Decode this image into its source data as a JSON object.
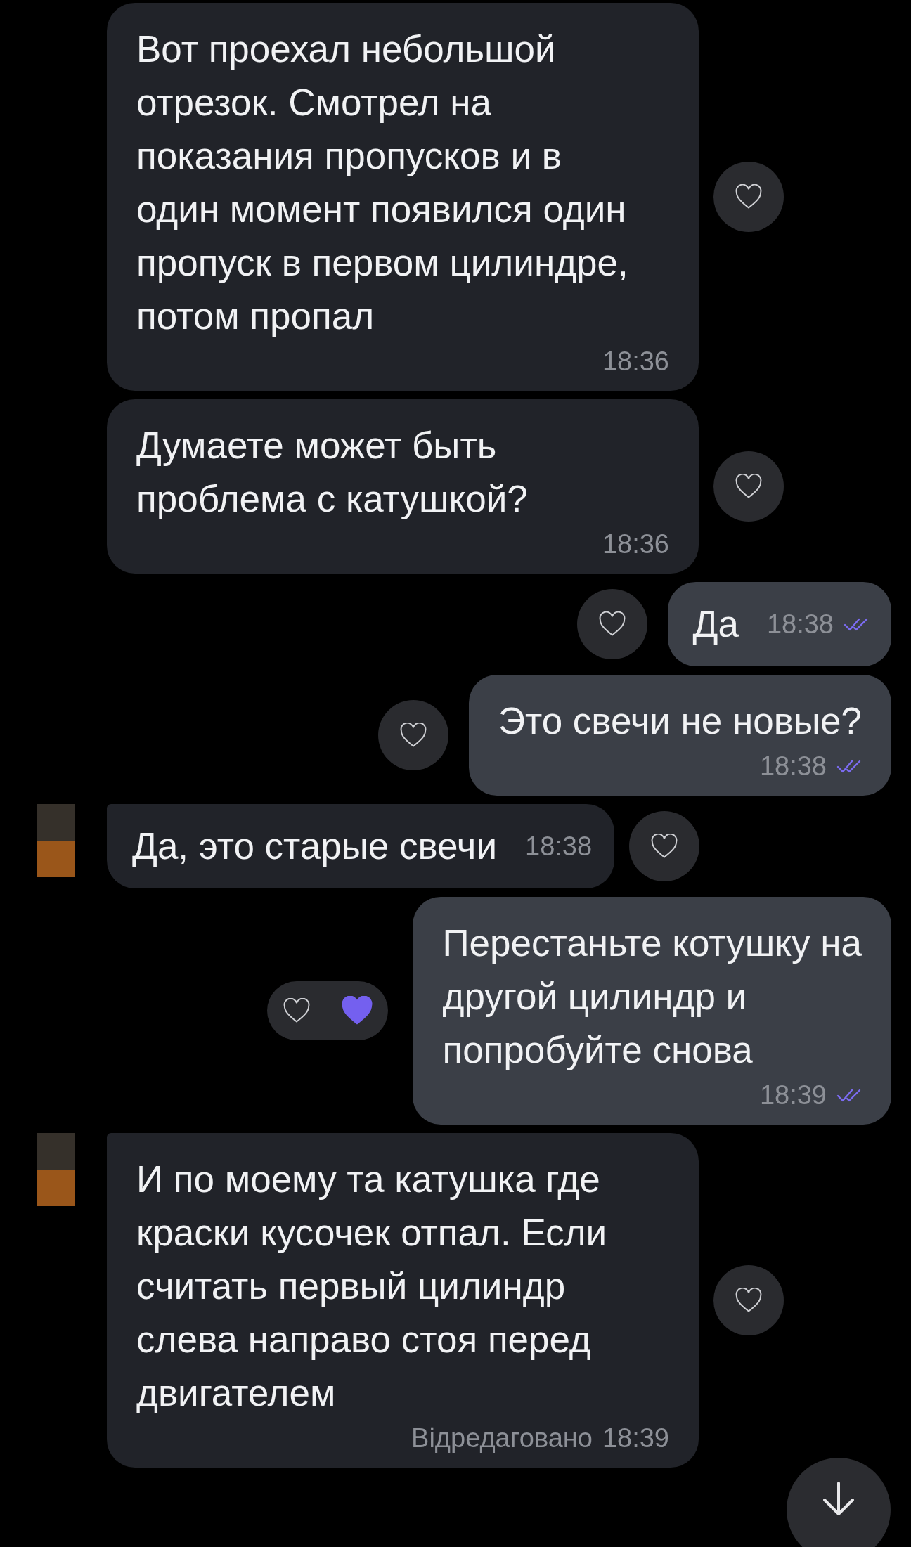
{
  "messages": [
    {
      "kind": "incoming",
      "text": "Вот проехал небольшой\nотрезок. Смотрел на\nпоказания пропусков и в\nодин момент появился один\nпропуск в первом цилиндре,\nпотом пропал",
      "time": "18:36",
      "avatar": false,
      "compact": false,
      "liked": false
    },
    {
      "kind": "incoming",
      "text": "Думаете может быть\nпроблема с катушкой?",
      "time": "18:36",
      "avatar": false,
      "compact": false,
      "liked": false
    },
    {
      "kind": "outgoing",
      "text": "Да",
      "time": "18:38",
      "read": true,
      "compact": true,
      "liked": false
    },
    {
      "kind": "outgoing",
      "text": "Это свечи не новые?",
      "time": "18:38",
      "read": true,
      "compact": false,
      "liked": false
    },
    {
      "kind": "incoming",
      "text": "Да, это старые свечи",
      "time": "18:38",
      "avatar": true,
      "compact": true,
      "liked": false
    },
    {
      "kind": "outgoing",
      "text": "Перестаньте котушку на\nдругой цилиндр и\nпопробуйте снова",
      "time": "18:39",
      "read": true,
      "compact": false,
      "liked": true
    },
    {
      "kind": "incoming",
      "text": "И по моему та катушка где\nкраски кусочек отпал. Если\nсчитать первый цилиндр\nслева направо стоя перед\nдвигателем",
      "edited": "Відредаговано",
      "time": "18:39",
      "avatar": true,
      "compact": false,
      "liked": false
    }
  ]
}
